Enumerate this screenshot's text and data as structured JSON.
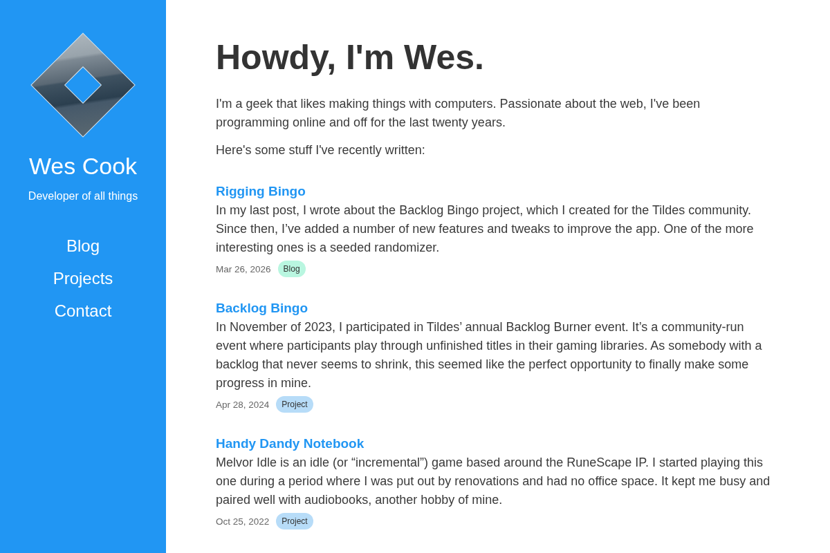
{
  "sidebar": {
    "name": "Wes Cook",
    "tagline": "Developer of all things",
    "nav": [
      "Blog",
      "Projects",
      "Contact"
    ]
  },
  "intro": {
    "heading": "Howdy, I'm Wes.",
    "paragraphs": [
      "I'm a geek that likes making things with computers. Passionate about the web, I've been programming online and off for the last twenty years.",
      "Here's some stuff I've recently written:"
    ]
  },
  "posts": [
    {
      "title": "Rigging Bingo",
      "summary": "In my last post, I wrote about the Backlog Bingo project, which I created for the Tildes community. Since then, I’ve added a number of new features and tweaks to improve the app. One of the more interesting ones is a seeded randomizer.",
      "date": "Mar 26, 2026",
      "tag": {
        "label": "Blog",
        "color": "#b9f6e0"
      }
    },
    {
      "title": "Backlog Bingo",
      "summary": "In November of 2023, I participated in Tildes’ annual Backlog Burner event. It’s a community-run event where participants play through unfinished titles in their gaming libraries. As somebody with a backlog that never seems to shrink, this seemed like the perfect opportunity to finally make some progress in mine.",
      "date": "Apr 28, 2024",
      "tag": {
        "label": "Project",
        "color": "#b7dcf8"
      }
    },
    {
      "title": "Handy Dandy Notebook",
      "summary": "Melvor Idle is an idle (or “incremental”) game based around the RuneScape IP. I started playing this one during a period where I was put out by renovations and had no office space. It kept me busy and paired well with audiobooks, another hobby of mine.",
      "date": "Oct 25, 2022",
      "tag": {
        "label": "Project",
        "color": "#b7dcf8"
      }
    }
  ]
}
